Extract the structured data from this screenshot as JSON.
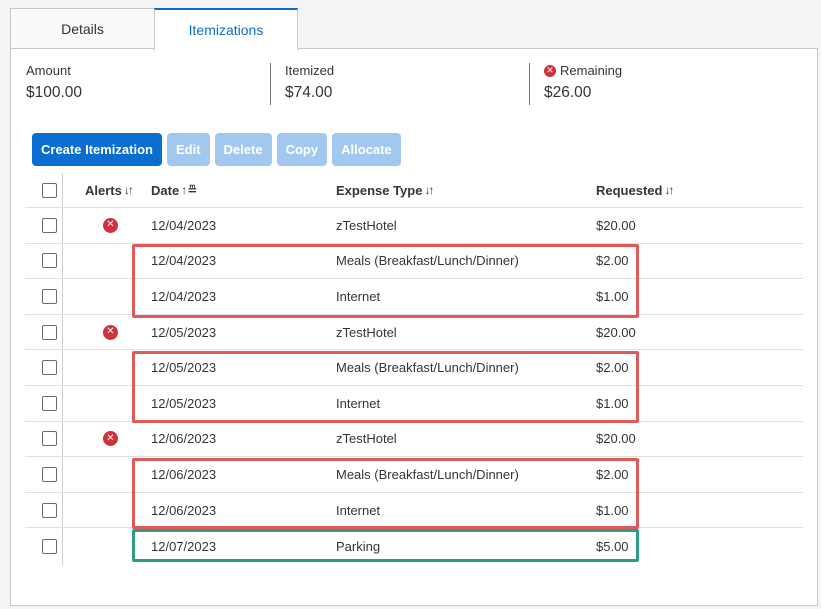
{
  "tabs": [
    {
      "label": "Details"
    },
    {
      "label": "Itemizations"
    }
  ],
  "summary": {
    "amount": {
      "label": "Amount",
      "value": "$100.00"
    },
    "itemized": {
      "label": "Itemized",
      "value": "$74.00"
    },
    "remaining": {
      "label": "Remaining",
      "value": "$26.00"
    }
  },
  "toolbar": {
    "create": "Create Itemization",
    "edit": "Edit",
    "delete": "Delete",
    "copy": "Copy",
    "allocate": "Allocate"
  },
  "table": {
    "headers": {
      "alerts": "Alerts",
      "date": "Date",
      "expense_type": "Expense Type",
      "requested": "Requested"
    },
    "rows": [
      {
        "alert": true,
        "date": "12/04/2023",
        "type": "zTestHotel",
        "requested": "$20.00"
      },
      {
        "alert": false,
        "date": "12/04/2023",
        "type": "Meals (Breakfast/Lunch/Dinner)",
        "requested": "$2.00"
      },
      {
        "alert": false,
        "date": "12/04/2023",
        "type": "Internet",
        "requested": "$1.00"
      },
      {
        "alert": true,
        "date": "12/05/2023",
        "type": "zTestHotel",
        "requested": "$20.00"
      },
      {
        "alert": false,
        "date": "12/05/2023",
        "type": "Meals (Breakfast/Lunch/Dinner)",
        "requested": "$2.00"
      },
      {
        "alert": false,
        "date": "12/05/2023",
        "type": "Internet",
        "requested": "$1.00"
      },
      {
        "alert": true,
        "date": "12/06/2023",
        "type": "zTestHotel",
        "requested": "$20.00"
      },
      {
        "alert": false,
        "date": "12/06/2023",
        "type": "Meals (Breakfast/Lunch/Dinner)",
        "requested": "$2.00"
      },
      {
        "alert": false,
        "date": "12/06/2023",
        "type": "Internet",
        "requested": "$1.00"
      },
      {
        "alert": false,
        "date": "12/07/2023",
        "type": "Parking",
        "requested": "$5.00"
      }
    ]
  },
  "colors": {
    "accent": "#0a6ed1",
    "error": "#d0323b",
    "highlight_red": "#e05a5a",
    "highlight_green": "#2e9c80"
  }
}
